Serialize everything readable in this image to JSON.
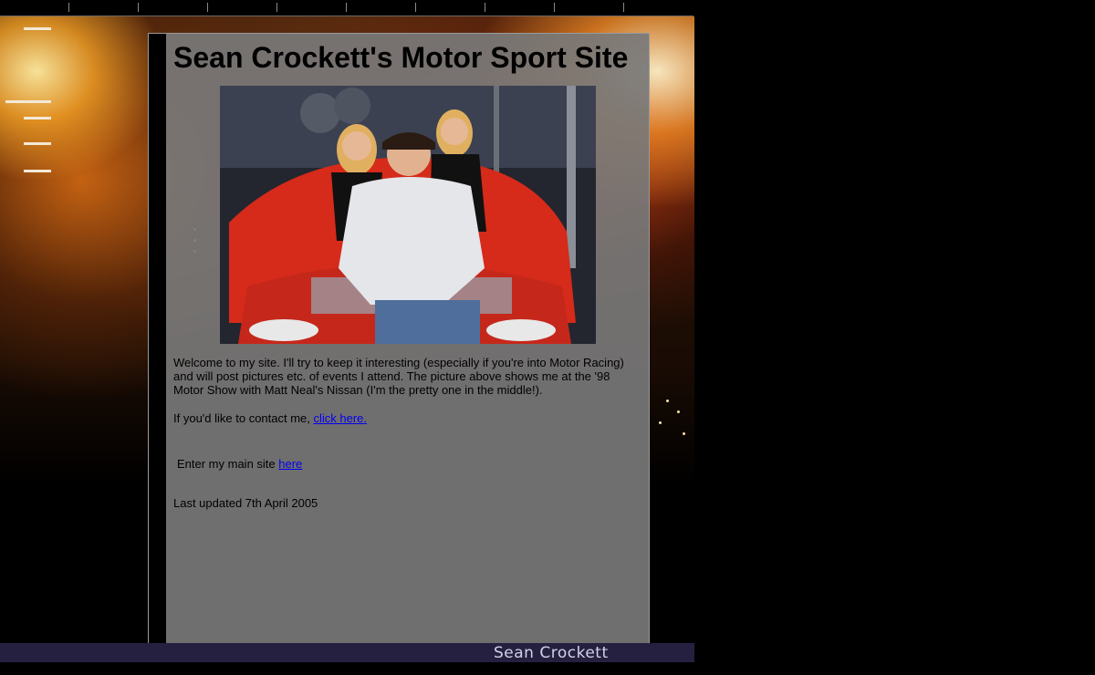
{
  "header": {
    "title": "Sean Crockett's Motor Sport Site"
  },
  "photo": {
    "alt": "Sean with Matt Neal's Nissan at the '98 Motor Show"
  },
  "intro": {
    "text": "Welcome to my site. I'll try to keep it interesting (especially if you're into Motor Racing) and will post pictures etc. of events I attend. The picture above shows me at the '98 Motor Show with Matt Neal's Nissan (I'm the pretty one in the middle!)."
  },
  "contact": {
    "prefix": "If you'd like to contact me, ",
    "link_label": "click here."
  },
  "main_site": {
    "prefix": "Enter my main site ",
    "link_label": "here"
  },
  "updated": {
    "text": "Last updated 7th April 2005"
  },
  "footer": {
    "signature": "Sean Crockett"
  }
}
